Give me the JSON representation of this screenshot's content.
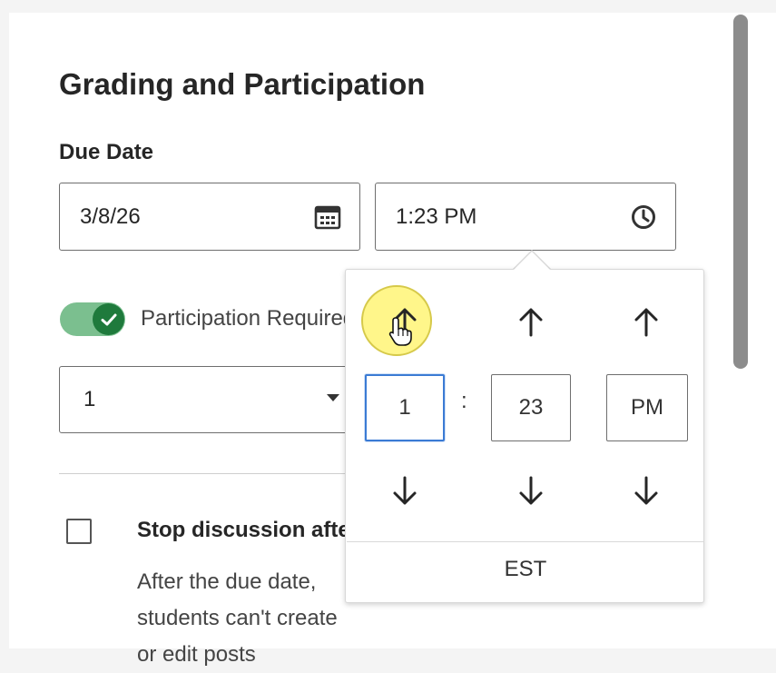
{
  "section": {
    "title": "Grading and Participation",
    "due_label": "Due Date"
  },
  "due_date": {
    "date_value": "3/8/26",
    "time_value": "1:23 PM"
  },
  "participation": {
    "label": "Participation Required",
    "toggle_on": true,
    "select_value": "1"
  },
  "stop_discussion": {
    "label": "Stop discussion after due date",
    "description": "After the due date, students can't create or edit posts",
    "checked": false
  },
  "time_picker": {
    "hour": "1",
    "separator": ":",
    "minute": "23",
    "meridiem": "PM",
    "timezone": "EST"
  },
  "colors": {
    "toggle_track": "#7bbf8f",
    "toggle_knob": "#1f7a3c",
    "focus_border": "#3b7bd4",
    "cursor_highlight": "#fff68a"
  },
  "icons": {
    "date": "calendar-icon",
    "time": "clock-icon",
    "toggle": "check-icon",
    "up": "arrow-up-icon",
    "down": "arrow-down-icon",
    "cursor": "hand-pointer-icon"
  }
}
